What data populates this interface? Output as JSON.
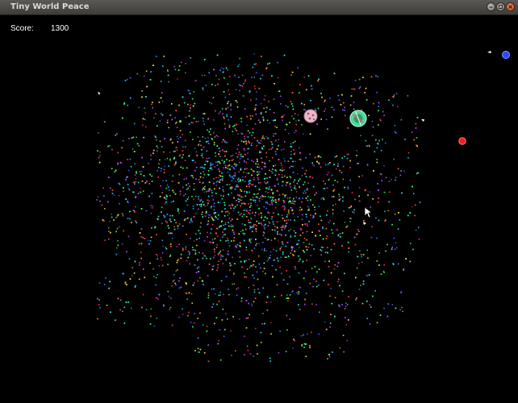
{
  "window": {
    "title": "Tiny World Peace",
    "buttons": {
      "minimize_icon": "minimize-icon",
      "maximize_icon": "maximize-icon",
      "close_icon": "close-icon"
    },
    "colors": {
      "titlebar": "#4b4a46",
      "title_text": "#dfdbd2",
      "close_button": "#e4582a"
    }
  },
  "hud": {
    "score_label": "Score:",
    "score_value": "1300"
  },
  "game": {
    "background": "#000000",
    "particle_colors": [
      "#ff2a5a",
      "#2ab8ff",
      "#37ff5a",
      "#ffe02a",
      "#b84aff",
      "#2affd2",
      "#ff6a2a",
      "#3a6aff"
    ],
    "entities": [
      {
        "name": "pink-planet-icon",
        "color": "#e9b8c8"
      },
      {
        "name": "green-planet-icon",
        "color": "#4fd69a"
      },
      {
        "name": "blue-orb-icon",
        "color": "#3245ff"
      },
      {
        "name": "red-orb-icon",
        "color": "#ff1a1a"
      },
      {
        "name": "mouse-cursor-icon",
        "color": "#ffffff"
      }
    ]
  }
}
